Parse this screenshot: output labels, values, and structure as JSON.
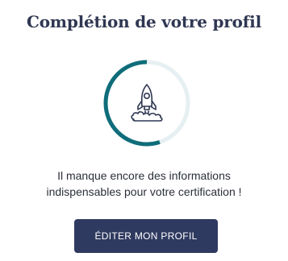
{
  "card": {
    "title": "Complétion de votre profil",
    "progress": {
      "fraction": 0.55,
      "track_color": "#e6eff1",
      "fill_color": "#0f6d7a"
    },
    "illustration_icon": "rocket-icon",
    "message": {
      "line1": "Il manque encore des informations",
      "line2": "indispensables pour votre certification !"
    },
    "edit_button_label": "ÉDITER MON PROFIL",
    "colors": {
      "title": "#2f3752",
      "button_bg": "#2f3a60",
      "button_text": "#ffffff"
    }
  }
}
